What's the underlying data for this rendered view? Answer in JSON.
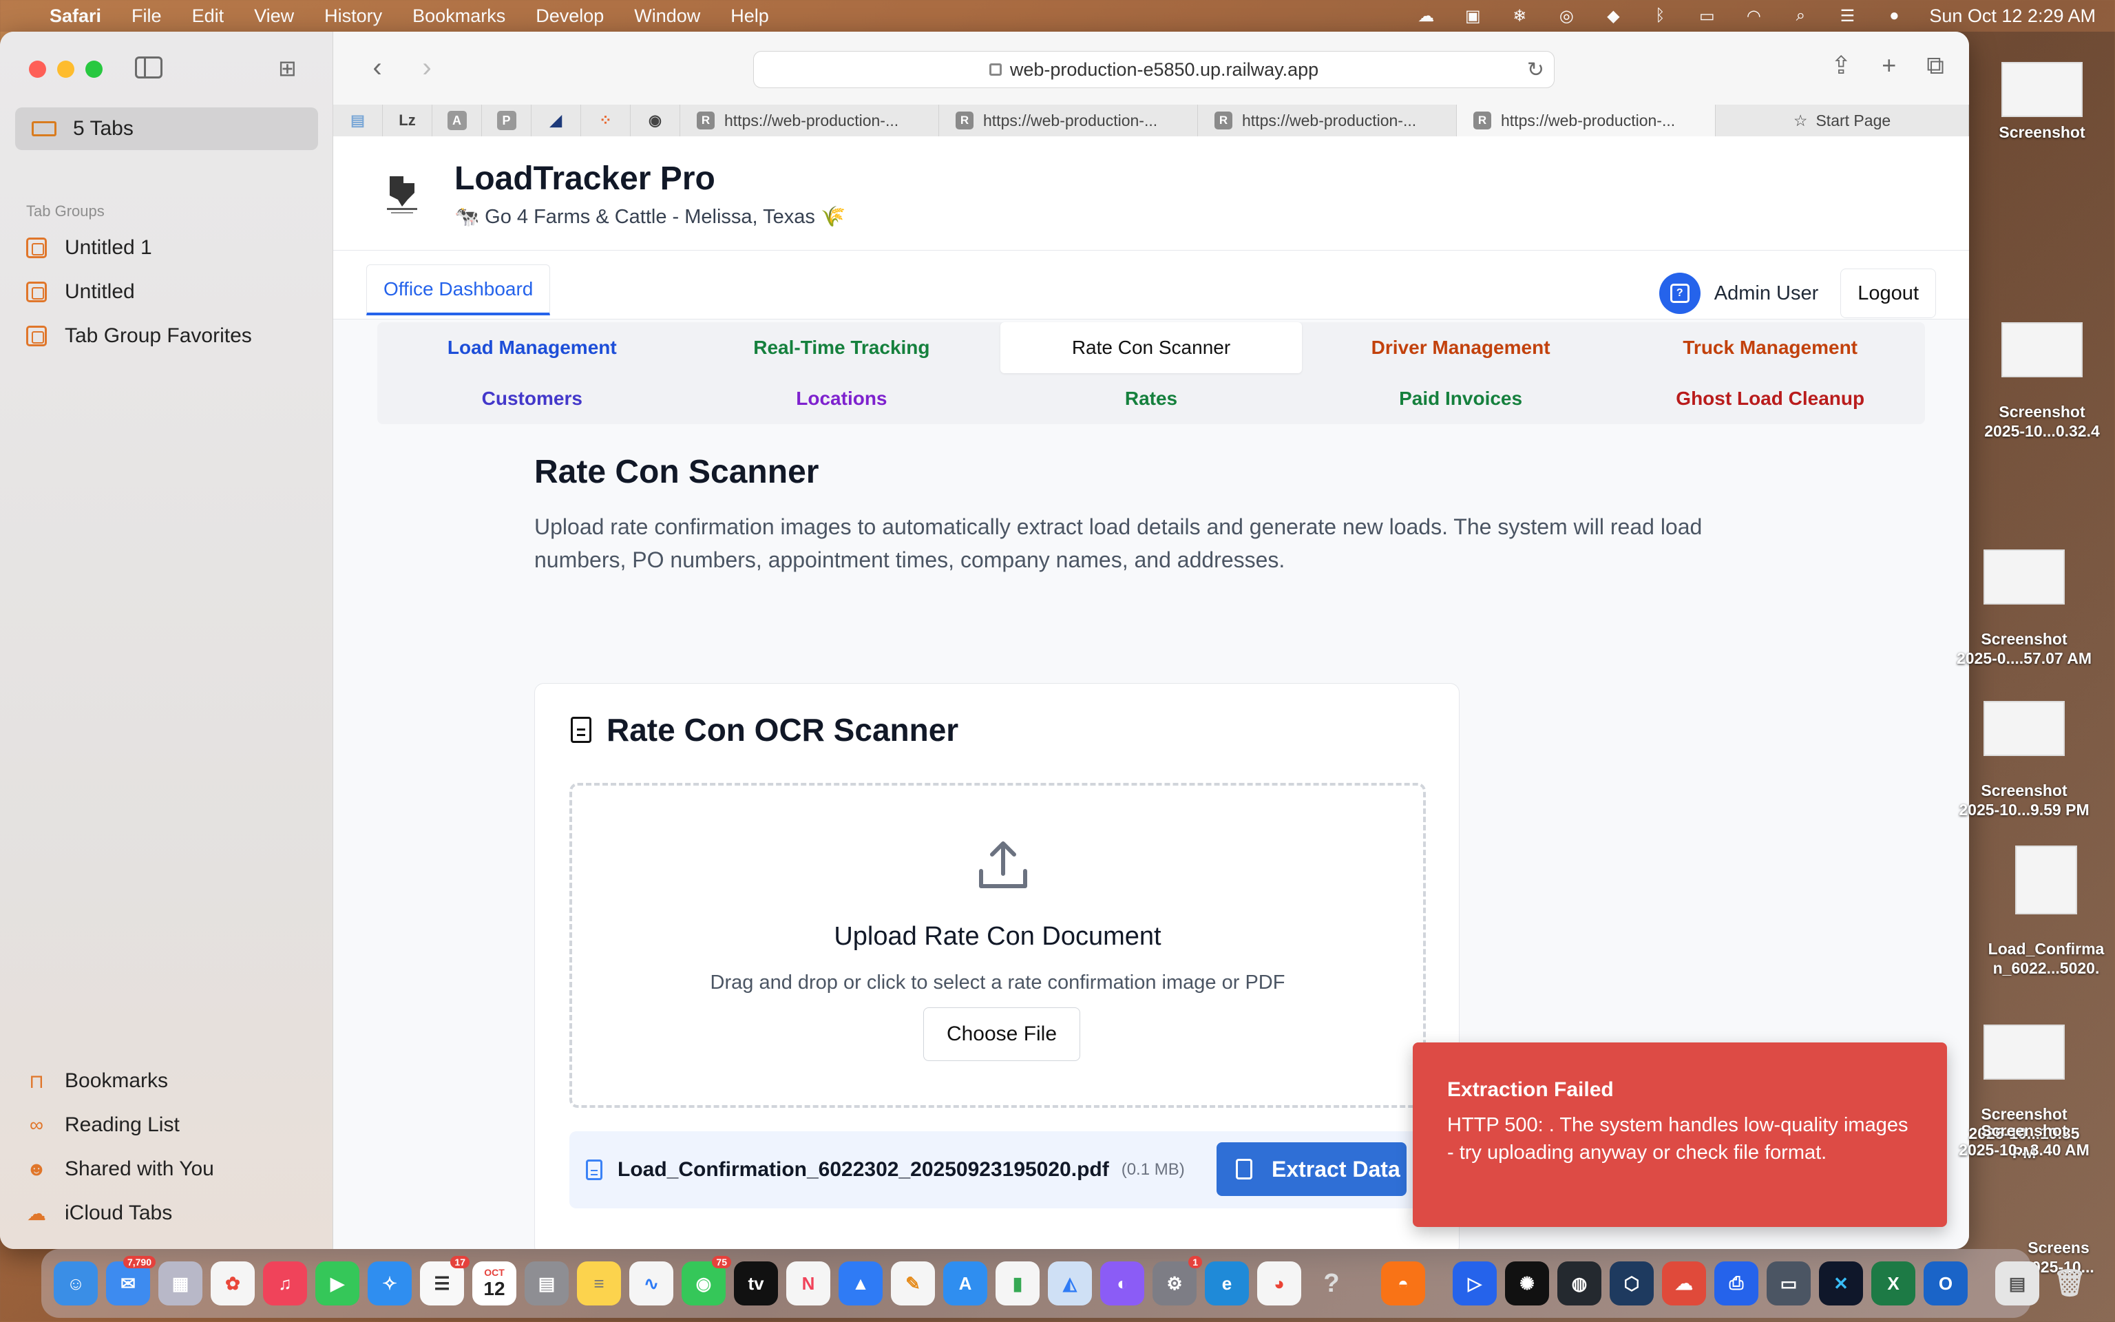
{
  "menubar": {
    "app": "Safari",
    "items": [
      "File",
      "Edit",
      "View",
      "History",
      "Bookmarks",
      "Develop",
      "Window",
      "Help"
    ],
    "datetime": "Sun Oct 12  2:29 AM"
  },
  "sidebar": {
    "tabs_label": "5 Tabs",
    "section_label": "Tab Groups",
    "groups": [
      "Untitled 1",
      "Untitled",
      "Tab Group Favorites"
    ],
    "bottom": [
      "Bookmarks",
      "Reading List",
      "Shared with You",
      "iCloud Tabs"
    ]
  },
  "toolbar": {
    "url": "web-production-e5850.up.railway.app",
    "tabs": [
      {
        "label": "https://web-production-..."
      },
      {
        "label": "https://web-production-..."
      },
      {
        "label": "https://web-production-..."
      },
      {
        "label": "https://web-production-..."
      }
    ],
    "start_page": "Start Page"
  },
  "app": {
    "title": "LoadTracker Pro",
    "subtitle": "🐄 Go 4 Farms & Cattle - Melissa, Texas 🌾",
    "office_tab": "Office Dashboard",
    "user": "Admin User",
    "logout": "Logout"
  },
  "tabs": [
    {
      "label": "Load Management",
      "color": "#1d4ed8"
    },
    {
      "label": "Real-Time Tracking",
      "color": "#15803d"
    },
    {
      "label": "Rate Con Scanner",
      "color": "#111111",
      "selected": true
    },
    {
      "label": "Driver Management",
      "color": "#c2410c"
    },
    {
      "label": "Truck Management",
      "color": "#c2410c"
    },
    {
      "label": "Customers",
      "color": "#4338ca"
    },
    {
      "label": "Locations",
      "color": "#7e22ce"
    },
    {
      "label": "Rates",
      "color": "#15803d"
    },
    {
      "label": "Paid Invoices",
      "color": "#15803d"
    },
    {
      "label": "Ghost Load Cleanup",
      "color": "#b91c1c"
    }
  ],
  "main": {
    "heading": "Rate Con Scanner",
    "description": "Upload rate confirmation images to automatically extract load details and generate new loads. The system will read load numbers, PO numbers, appointment times, company names, and addresses."
  },
  "scanner": {
    "title": "Rate Con OCR Scanner",
    "upload_title": "Upload Rate Con Document",
    "upload_sub": "Drag and drop or click to select a rate confirmation image or PDF",
    "choose_file": "Choose File",
    "file_name": "Load_Confirmation_6022302_20250923195020.pdf",
    "file_size": "(0.1 MB)",
    "extract": "Extract Data"
  },
  "toast": {
    "title": "Extraction Failed",
    "message": "HTTP 500: . The system handles low-quality images - try uploading anyway or check file format."
  },
  "desktop": [
    {
      "label": "Screenshot"
    },
    {
      "label": "Screenshot\n2025-10...0.32.4"
    },
    {
      "label": "Screenshot\n2025-0....57.07 AM"
    },
    {
      "label": "Screenshot\n2025-10...9.59 PM"
    },
    {
      "label": "Load_Confirma\nn_6022...5020."
    },
    {
      "label": "Screenshot\n2025-10...10.35 PM"
    },
    {
      "label": "Screenshot\n2025-10...3.40 AM"
    },
    {
      "label": "Screens\n2025-10..."
    }
  ],
  "dock": {
    "mail_badge": "7,790",
    "reminders_badge": "17",
    "messages_badge": "75",
    "settings_badge": "1",
    "calendar_month": "OCT",
    "calendar_day": "12"
  }
}
